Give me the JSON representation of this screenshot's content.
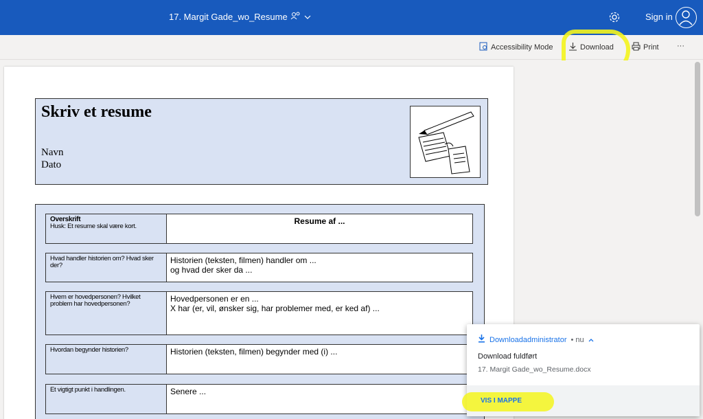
{
  "topbar": {
    "doc_title": "17. Margit Gade_wo_Resume",
    "collab_icon": "ꞈᴿ",
    "sign_in": "Sign in"
  },
  "commands": {
    "accessibility": "Accessibility Mode",
    "download": "Download",
    "print": "Print",
    "more": "···"
  },
  "document": {
    "title": "Skriv et resume",
    "navn": "Navn",
    "dato": "Dato",
    "rows": [
      {
        "q_title": "Overskrift",
        "q": "Husk: Et resume skal være kort.",
        "a": "Resume af ..."
      },
      {
        "q": "Hvad handler historien om? Hvad sker der?",
        "a1": "Historien (teksten, filmen) handler om ...",
        "a2": "og hvad der sker da ..."
      },
      {
        "q": "Hvem er hovedpersonen? Hvilket problem har hovedpersonen?",
        "a1": "Hovedpersonen er en ...",
        "a2": "X har (er, vil, ønsker sig, har problemer med, er ked af) ..."
      },
      {
        "q": "Hvordan begynder historien?",
        "a": "Historien (teksten, filmen) begynder med (i) ..."
      },
      {
        "q": "Et vigtigt punkt i handlingen.",
        "a": "Senere ..."
      }
    ]
  },
  "download_popup": {
    "title": "Downloadadministrator",
    "time": "• nu",
    "status": "Download fuldført",
    "file_name": "17. Margit Gade_wo_Resume.docx",
    "action": "VIS I MAPPE"
  },
  "colors": {
    "brand": "#185abd",
    "highlight": "#f4f41d",
    "link": "#1a73e8"
  }
}
